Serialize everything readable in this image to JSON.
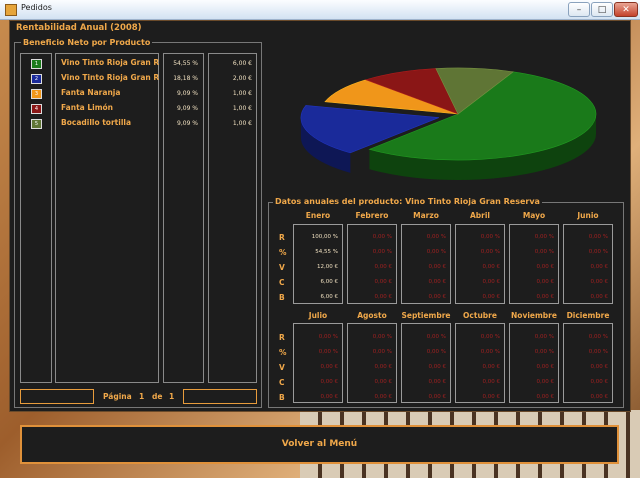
{
  "window": {
    "title": "Pedidos",
    "min": "–",
    "max": "□",
    "close": "✕"
  },
  "panel_title": "Rentabilidad Anual (2008)",
  "legend": {
    "title": "Beneficio Neto por Producto",
    "items": [
      {
        "num": "1",
        "name": "Vino Tinto Rioja Gran R",
        "pct": "54,55 %",
        "val": "6,00 €",
        "color": "#1a7a1a"
      },
      {
        "num": "2",
        "name": "Vino Tinto Rioja Gran R",
        "pct": "18,18 %",
        "val": "2,00 €",
        "color": "#1a2a9a"
      },
      {
        "num": "3",
        "name": "Fanta Naranja",
        "pct": "9,09 %",
        "val": "1,00 €",
        "color": "#f0961a"
      },
      {
        "num": "4",
        "name": "Fanta Limón",
        "pct": "9,09 %",
        "val": "1,00 €",
        "color": "#8a1616"
      },
      {
        "num": "5",
        "name": "Bocadillo tortilla",
        "pct": "9,09 %",
        "val": "1,00 €",
        "color": "#5f7535"
      }
    ],
    "pager": {
      "label": "Página",
      "current": "1",
      "sep": "de",
      "total": "1"
    }
  },
  "chart_data": {
    "type": "pie",
    "labels": [
      "Vino Tinto Rioja Gran R",
      "Vino Tinto Rioja Gran R",
      "Fanta Naranja",
      "Fanta Limón",
      "Bocadillo tortilla"
    ],
    "values": [
      54.55,
      18.18,
      9.09,
      9.09,
      9.09
    ],
    "colors": [
      "#1a7a1a",
      "#1a2a9a",
      "#f0961a",
      "#8a1616",
      "#5f7535"
    ],
    "exploded": [
      false,
      true,
      false,
      false,
      false
    ]
  },
  "annual": {
    "title": "Datos anuales del producto: Vino Tinto Rioja Gran Reserva",
    "row_labels": [
      "R",
      "%",
      "V",
      "C",
      "B"
    ],
    "months_row1": [
      "Enero",
      "Febrero",
      "Marzo",
      "Abril",
      "Mayo",
      "Junio"
    ],
    "months_row2": [
      "Julio",
      "Agosto",
      "Septiembre",
      "Octubre",
      "Noviembre",
      "Diciembre"
    ],
    "enero_values": [
      "100,00 %",
      "54,55 %",
      "12,00 €",
      "6,00 €",
      "6,00 €"
    ],
    "empty_values": [
      "0,00 %",
      "0,00 %",
      "0,00 €",
      "0,00 €",
      "0,00 €"
    ]
  },
  "back_button": "Volver al Menú"
}
